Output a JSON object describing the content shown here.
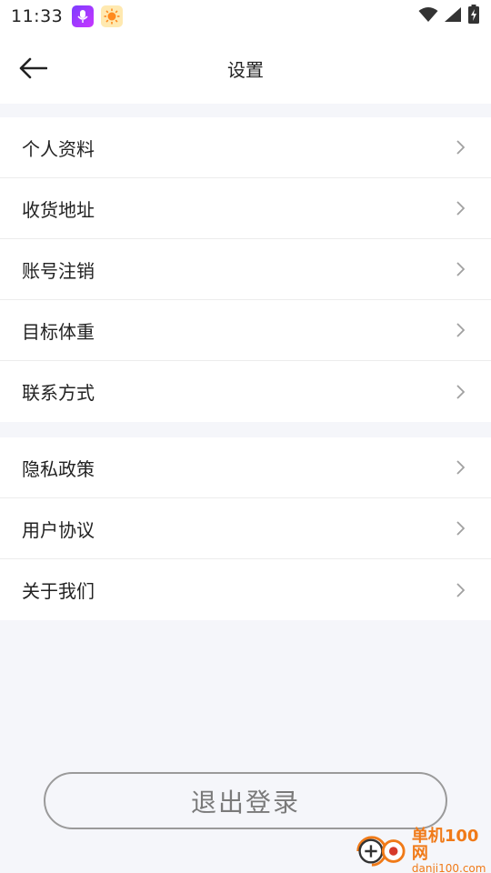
{
  "status_bar": {
    "time": "11:33",
    "icons": [
      "mic-app-icon",
      "sun-app-icon",
      "wifi-icon",
      "signal-icon",
      "battery-icon"
    ]
  },
  "header": {
    "title": "设置",
    "back_icon": "back-arrow-icon"
  },
  "groups": [
    {
      "items": [
        {
          "label": "个人资料"
        },
        {
          "label": "收货地址"
        },
        {
          "label": "账号注销"
        },
        {
          "label": "目标体重"
        },
        {
          "label": "联系方式"
        }
      ]
    },
    {
      "items": [
        {
          "label": "隐私政策"
        },
        {
          "label": "用户协议"
        },
        {
          "label": "关于我们"
        }
      ]
    }
  ],
  "logout": {
    "label": "退出登录"
  },
  "watermark": {
    "cn": "单机100网",
    "en": "danji100.com"
  },
  "colors": {
    "background": "#f5f6fa",
    "card": "#ffffff",
    "text": "#222222",
    "chevron": "#a0a0a0",
    "logout_border": "#9a9a9a",
    "watermark": "#f07a18"
  }
}
